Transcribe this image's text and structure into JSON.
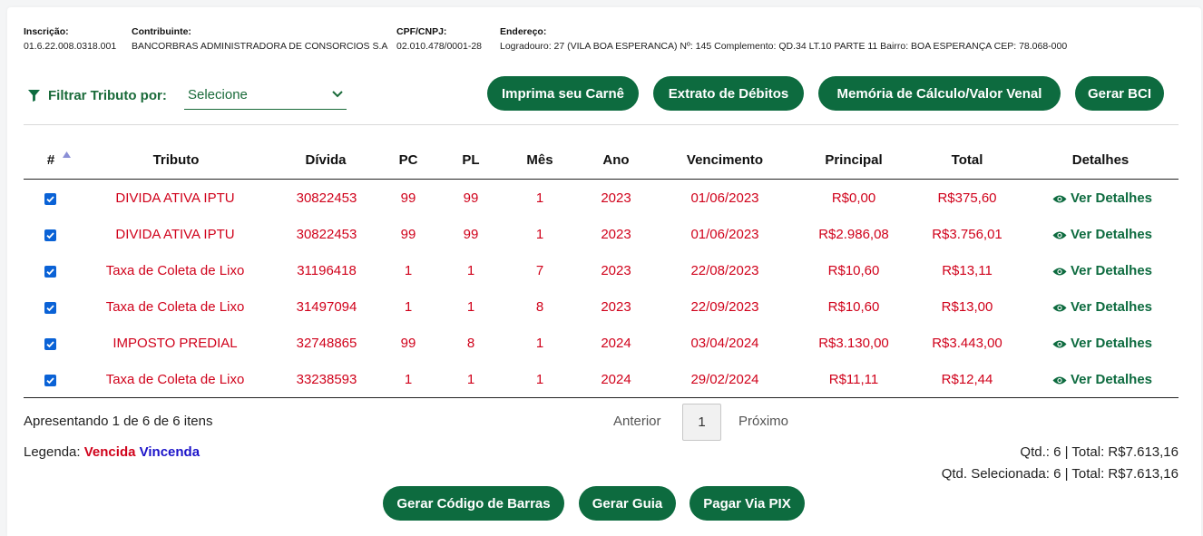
{
  "header": {
    "inscricao_label": "Inscrição:",
    "inscricao_value": "01.6.22.008.0318.001",
    "contribuinte_label": "Contribuinte:",
    "contribuinte_value": "BANCORBRAS ADMINISTRADORA DE CONSORCIOS S.A",
    "cpf_label": "CPF/CNPJ:",
    "cpf_value": "02.010.478/0001-28",
    "endereco_label": "Endereço:",
    "endereco_value": "Logradouro: 27 (VILA BOA ESPERANCA) Nº: 145 Complemento: QD.34 LT.10 PARTE 11 Bairro: BOA ESPERANÇA CEP: 78.068-000"
  },
  "filter": {
    "label": "Filtrar Tributo por:",
    "select_value": "Selecione"
  },
  "actions": {
    "carne": "Imprima seu Carnê",
    "extrato": "Extrato de Débitos",
    "memoria": "Memória de Cálculo/Valor Venal",
    "bci": "Gerar BCI"
  },
  "table": {
    "columns": [
      "#",
      "Tributo",
      "Dívida",
      "PC",
      "PL",
      "Mês",
      "Ano",
      "Vencimento",
      "Principal",
      "Total",
      "Detalhes"
    ],
    "details_label": "Ver Detalhes",
    "rows": [
      {
        "checked": true,
        "tributo": "DIVIDA ATIVA IPTU",
        "divida": "30822453",
        "pc": "99",
        "pl": "99",
        "mes": "1",
        "ano": "2023",
        "vencimento": "01/06/2023",
        "principal": "R$0,00",
        "total": "R$375,60"
      },
      {
        "checked": true,
        "tributo": "DIVIDA ATIVA IPTU",
        "divida": "30822453",
        "pc": "99",
        "pl": "99",
        "mes": "1",
        "ano": "2023",
        "vencimento": "01/06/2023",
        "principal": "R$2.986,08",
        "total": "R$3.756,01"
      },
      {
        "checked": true,
        "tributo": "Taxa de Coleta de Lixo",
        "divida": "31196418",
        "pc": "1",
        "pl": "1",
        "mes": "7",
        "ano": "2023",
        "vencimento": "22/08/2023",
        "principal": "R$10,60",
        "total": "R$13,11"
      },
      {
        "checked": true,
        "tributo": "Taxa de Coleta de Lixo",
        "divida": "31497094",
        "pc": "1",
        "pl": "1",
        "mes": "8",
        "ano": "2023",
        "vencimento": "22/09/2023",
        "principal": "R$10,60",
        "total": "R$13,00"
      },
      {
        "checked": true,
        "tributo": "IMPOSTO PREDIAL",
        "divida": "32748865",
        "pc": "99",
        "pl": "8",
        "mes": "1",
        "ano": "2024",
        "vencimento": "03/04/2024",
        "principal": "R$3.130,00",
        "total": "R$3.443,00"
      },
      {
        "checked": true,
        "tributo": "Taxa de Coleta de Lixo",
        "divida": "33238593",
        "pc": "1",
        "pl": "1",
        "mes": "1",
        "ano": "2024",
        "vencimento": "29/02/2024",
        "principal": "R$11,11",
        "total": "R$12,44"
      }
    ]
  },
  "footer": {
    "showing": "Apresentando 1 de 6 de 6 itens",
    "prev": "Anterior",
    "page": "1",
    "next": "Próximo",
    "legend_label": "Legenda:",
    "legend_vencida": "Vencida",
    "legend_vincenda": "Vincenda",
    "qtd_total": "Qtd.: 6 | Total: R$7.613,16",
    "qtd_selecionada": "Qtd. Selecionada: 6 | Total: R$7.613,16"
  },
  "bottom_actions": {
    "barcode": "Gerar Código de Barras",
    "guia": "Gerar Guia",
    "pix": "Pagar Via PIX"
  },
  "colors": {
    "primary_green": "#0d6b3f",
    "overdue_red": "#d0021b",
    "upcoming_blue": "#1b13c9",
    "checkbox_blue": "#0a62d6"
  },
  "icons": {
    "filter": "filter-icon",
    "select": "chevron-down-icon",
    "sort": "sort-asc-icon",
    "details": "eye-icon",
    "checkbox": "checkmark-icon"
  }
}
